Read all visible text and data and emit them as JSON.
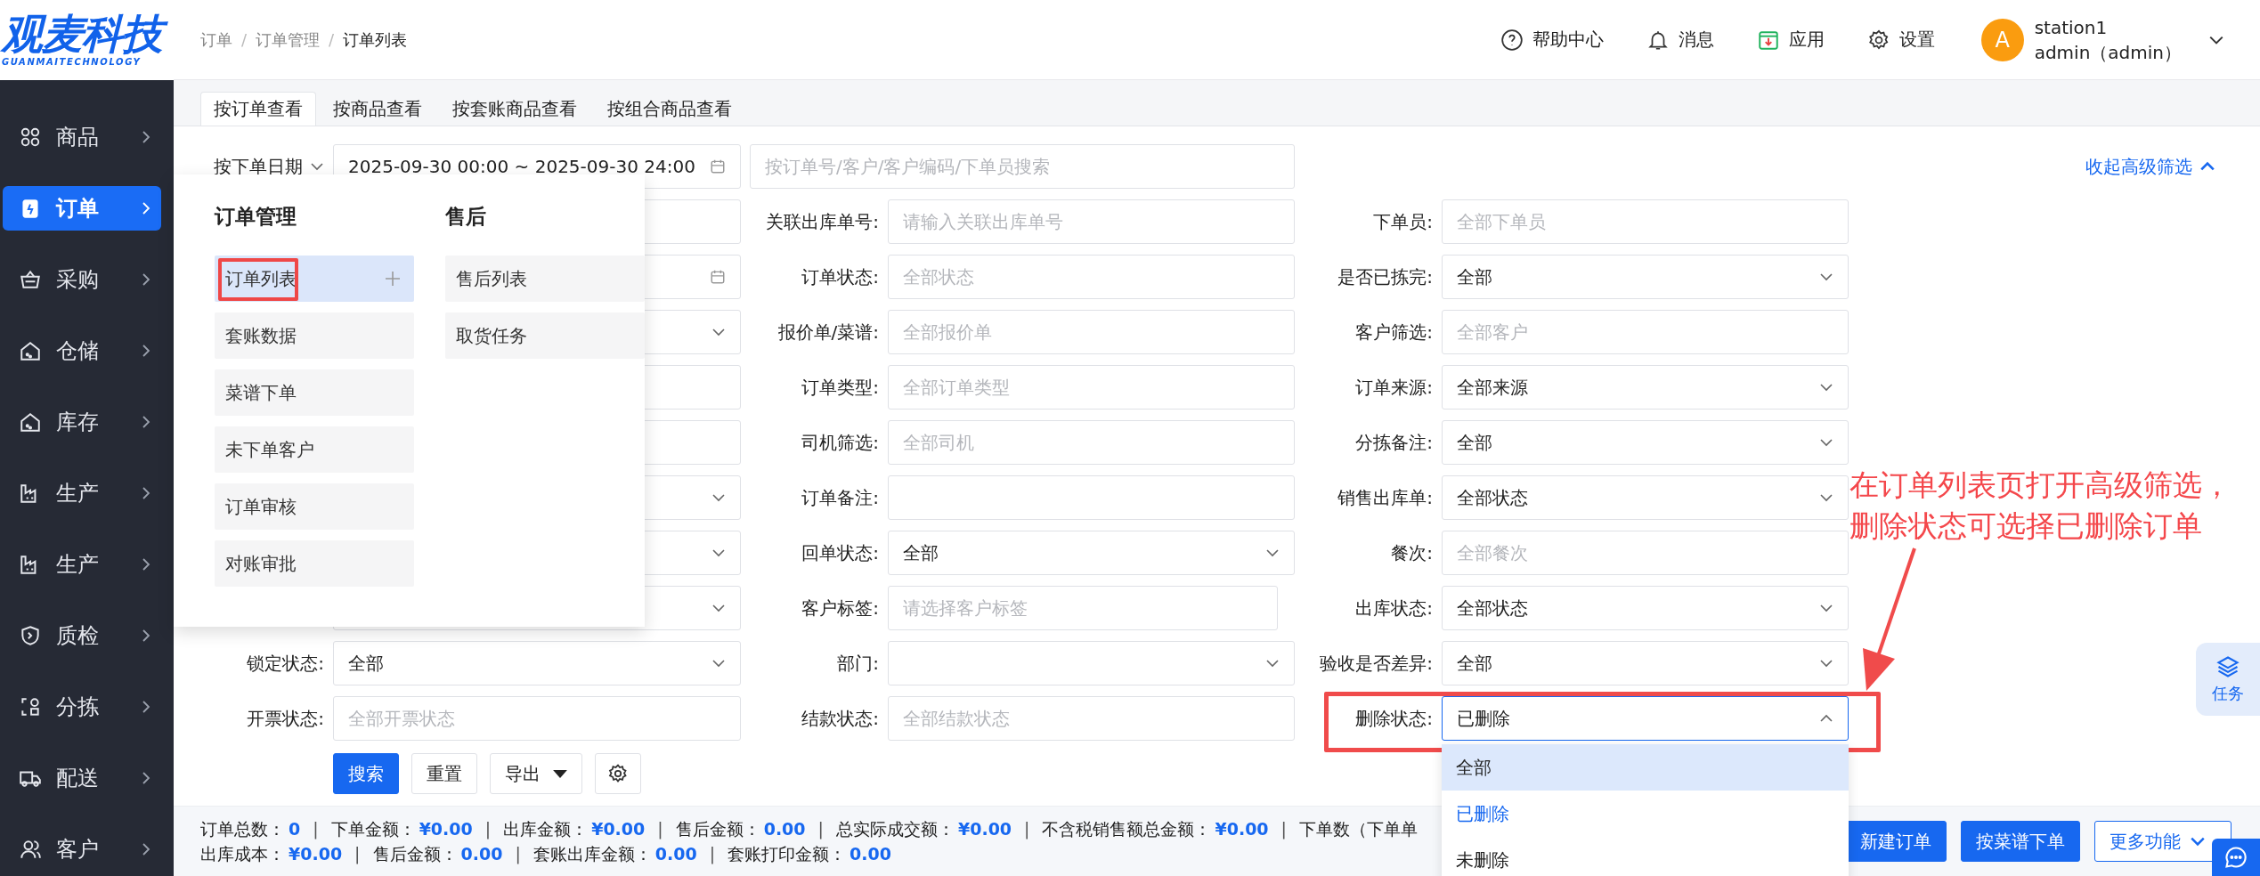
{
  "logo": {
    "name": "观麦科技",
    "subtitle": "GUANMAITECHNOLOGY"
  },
  "sidebar": {
    "items": [
      {
        "label": "商品",
        "selected": false
      },
      {
        "label": "订单",
        "selected": true
      },
      {
        "label": "采购",
        "selected": false
      },
      {
        "label": "仓储",
        "selected": false
      },
      {
        "label": "库存",
        "selected": false
      },
      {
        "label": "生产",
        "selected": false
      },
      {
        "label": "生产",
        "selected": false
      },
      {
        "label": "质检",
        "selected": false
      },
      {
        "label": "分拣",
        "selected": false
      },
      {
        "label": "配送",
        "selected": false
      },
      {
        "label": "客户",
        "selected": false
      }
    ]
  },
  "breadcrumb": {
    "separator": "/",
    "items": [
      "订单",
      "订单管理",
      "订单列表"
    ]
  },
  "header_actions": [
    {
      "label": "帮助中心"
    },
    {
      "label": "消息"
    },
    {
      "label": "应用"
    },
    {
      "label": "设置"
    }
  ],
  "user": {
    "avatar": "A",
    "station": "station1",
    "account": "admin（admin）"
  },
  "tabs": [
    {
      "label": "按订单查看",
      "selected": true
    },
    {
      "label": "按商品查看",
      "selected": false
    },
    {
      "label": "按套账商品查看",
      "selected": false
    },
    {
      "label": "按组合商品查看",
      "selected": false
    }
  ],
  "filters": {
    "date_type": "按下单日期",
    "date_range": "2025-09-30 00:00 ~ 2025-09-30 24:00",
    "search_placeholder": "按订单号/客户/客户编码/下单员搜索",
    "collapse_link": "收起高级筛选",
    "left": [
      {
        "kind": "input"
      },
      {
        "kind": "date"
      },
      {
        "kind": "select",
        "expanded": false
      },
      {
        "kind": "input"
      },
      {
        "kind": "input"
      },
      {
        "kind": "select",
        "expanded": false
      },
      {
        "kind": "select",
        "expanded": false
      },
      {
        "kind": "select",
        "expanded": false
      },
      {
        "kind": "select",
        "label": "锁定状态:",
        "value": "全部",
        "expanded": false
      },
      {
        "kind": "input",
        "label": "开票状态:",
        "placeholder": "全部开票状态"
      }
    ],
    "middle": [
      {
        "kind": "input",
        "label": "关联出库单号:",
        "placeholder": "请输入关联出库单号"
      },
      {
        "kind": "input",
        "label": "订单状态:",
        "placeholder": "全部状态"
      },
      {
        "kind": "input",
        "label": "报价单/菜谱:",
        "placeholder": "全部报价单"
      },
      {
        "kind": "input",
        "label": "订单类型:",
        "placeholder": "全部订单类型"
      },
      {
        "kind": "input",
        "label": "司机筛选:",
        "placeholder": "全部司机"
      },
      {
        "kind": "input",
        "label": "订单备注:"
      },
      {
        "kind": "select",
        "label": "回单状态:",
        "value": "全部",
        "expanded": false
      },
      {
        "kind": "tags",
        "label": "客户标签:",
        "placeholder": "请选择客户标签"
      },
      {
        "kind": "select",
        "label": "部门:",
        "expanded": false
      },
      {
        "kind": "input",
        "label": "结款状态:",
        "placeholder": "全部结款状态"
      }
    ],
    "right": [
      {
        "kind": "input",
        "label": "下单员:",
        "placeholder": "全部下单员"
      },
      {
        "kind": "select",
        "label": "是否已拣完:",
        "value": "全部",
        "expanded": false
      },
      {
        "kind": "input",
        "label": "客户筛选:",
        "placeholder": "全部客户"
      },
      {
        "kind": "select",
        "label": "订单来源:",
        "value": "全部来源",
        "expanded": false
      },
      {
        "kind": "select",
        "label": "分拣备注:",
        "value": "全部",
        "expanded": false
      },
      {
        "kind": "select",
        "label": "销售出库单:",
        "value": "全部状态",
        "expanded": false
      },
      {
        "kind": "input",
        "label": "餐次:",
        "placeholder": "全部餐次"
      },
      {
        "kind": "select",
        "label": "出库状态:",
        "value": "全部状态",
        "expanded": false
      },
      {
        "kind": "select",
        "label": "验收是否差异:",
        "value": "全部",
        "expanded": false
      },
      {
        "kind": "select",
        "label": "删除状态:",
        "value": "已删除",
        "expanded": true,
        "options": [
          {
            "label": "全部",
            "hovered": true,
            "selected": false
          },
          {
            "label": "已删除",
            "hovered": false,
            "selected": true
          },
          {
            "label": "未删除",
            "hovered": false,
            "selected": false
          }
        ]
      }
    ]
  },
  "form_buttons": [
    {
      "kind": "primary",
      "label": "搜索"
    },
    {
      "kind": "default",
      "label": "重置"
    },
    {
      "kind": "menu",
      "label": "导出"
    },
    {
      "kind": "settings"
    }
  ],
  "menu_popup": {
    "groups": [
      {
        "title": "订单管理",
        "items": [
          {
            "label": "订单列表",
            "selected": true
          },
          {
            "label": "套账数据",
            "selected": false
          },
          {
            "label": "菜谱下单",
            "selected": false
          },
          {
            "label": "未下单客户",
            "selected": false
          },
          {
            "label": "订单审核",
            "selected": false
          },
          {
            "label": "对账审批",
            "selected": false
          }
        ]
      },
      {
        "title": "售后",
        "items": [
          {
            "label": "售后列表",
            "selected": false
          },
          {
            "label": "取货任务",
            "selected": false
          }
        ]
      }
    ]
  },
  "summary": {
    "separator": "|",
    "rows": [
      [
        {
          "label": "订单总数：",
          "value": "0"
        },
        {
          "label": "下单金额：",
          "value": "¥0.00"
        },
        {
          "label": "出库金额：",
          "value": "¥0.00"
        },
        {
          "label": "售后金额：",
          "value": "0.00"
        },
        {
          "label": "总实际成交额：",
          "value": "¥0.00"
        },
        {
          "label": "不含税销售额总金额：",
          "value": "¥0.00"
        },
        {
          "label": "下单数（下单单"
        }
      ],
      [
        {
          "label": "出库成本：",
          "value": "¥0.00"
        },
        {
          "label": "售后金额：",
          "value": "0.00"
        },
        {
          "label": "套账出库金额：",
          "value": "0.00"
        },
        {
          "label": "套账打印金额：",
          "value": "0.00"
        }
      ]
    ]
  },
  "footer_buttons": [
    {
      "kind": "primary",
      "label": "新建订单"
    },
    {
      "kind": "primary",
      "label": "按菜谱下单"
    },
    {
      "kind": "menu",
      "label": "更多功能"
    }
  ],
  "task_button": {
    "label": "任务"
  },
  "annotation": {
    "lines": [
      "在订单列表页打开高级筛选，",
      "删除状态可选择已删除订单"
    ]
  }
}
